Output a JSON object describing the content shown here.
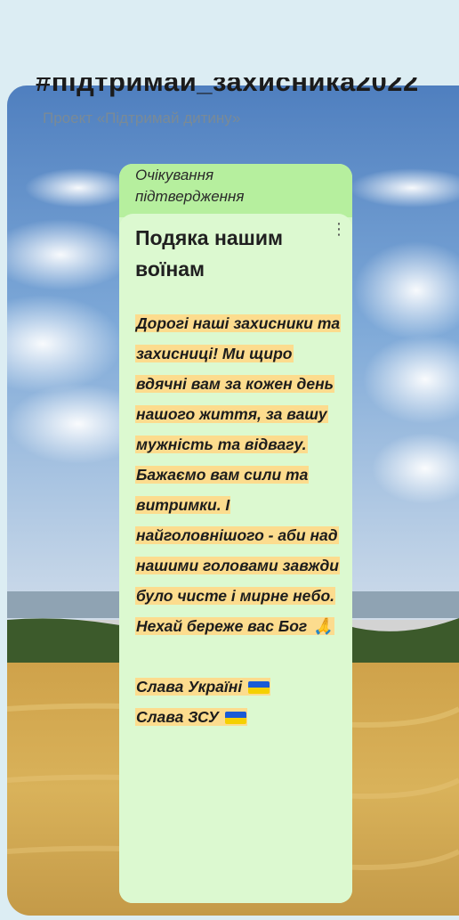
{
  "wall": {
    "title": "#підтримай_захисника2022",
    "subtitle": "Проект «Підтримай дитину»"
  },
  "post": {
    "status": "Очікування підтвердження",
    "title": "Подяка нашим воїнам",
    "body_lines": [
      "Дорогі наші захисники та захисниці! Ми щиро вдячні вам за кожен день нашого життя, за вашу мужність та відвагу. Бажаємо вам сили та витримки. І найголовнішого - аби над нашими головами завжди було чисте і мирне небо. Нехай береже вас Бог"
    ],
    "closing_1": "Слава Україні",
    "closing_2": "Слава ЗСУ",
    "menu_icon": "more-vertical-icon",
    "emoji_pray": "🙏",
    "flag_colors": [
      "#1a5bd6",
      "#f5d000"
    ]
  },
  "colors": {
    "highlight": "#fcdc8e",
    "card_bg": "#dcf9d0",
    "pending_bg": "#b6ef9e"
  }
}
